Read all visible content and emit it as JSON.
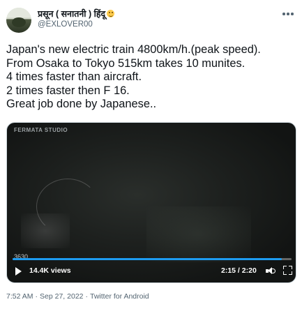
{
  "author": {
    "display_name": "प्रसून ( सनातनी ) हिंदू",
    "handle": "@EXLOVER00"
  },
  "tweet": {
    "lines": [
      "Japan's new electric train 4800km/h.(peak speed).",
      "From Osaka to Tokyo 515km takes 10 munites.",
      "4 times faster than aircraft.",
      "2 times faster then F 16.",
      "Great job done by Japanese.."
    ]
  },
  "video": {
    "watermark": "FERMATA STUDIO",
    "readout": "3630",
    "views": "14.4K views",
    "time": "2:15 / 2:20",
    "progress_fraction": 0.964,
    "progress_color": "#1d9bf0"
  },
  "meta": {
    "time": "7:52 AM",
    "date": "Sep 27, 2022",
    "separator": "·",
    "source": "Twitter for Android"
  },
  "icons": {
    "more": "more-horizontal-icon",
    "play": "play-icon",
    "volume": "speaker-icon",
    "fullscreen": "fullscreen-icon"
  }
}
